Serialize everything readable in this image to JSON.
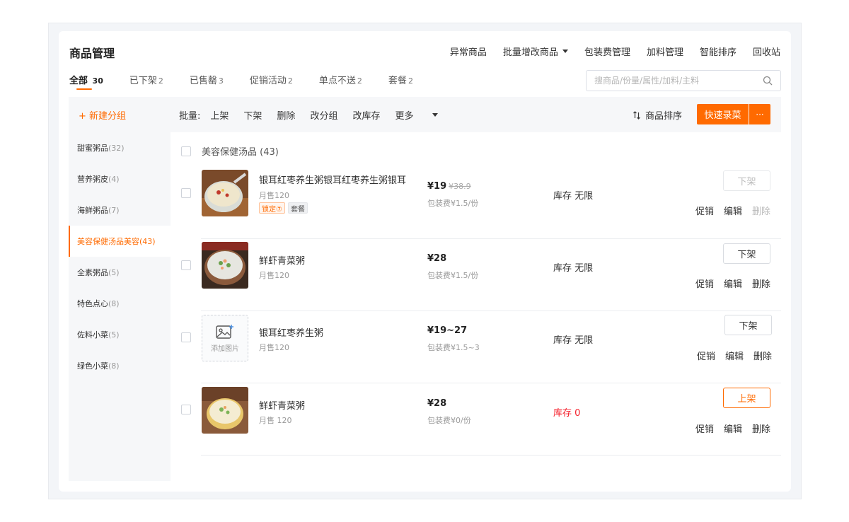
{
  "page": {
    "title": "商品管理",
    "top_actions": [
      "异常商品",
      "批量增改商品",
      "包装费管理",
      "加料管理",
      "智能排序",
      "回收站"
    ]
  },
  "tabs": [
    {
      "label": "全部",
      "count": "30"
    },
    {
      "label": "已下架",
      "count": "2"
    },
    {
      "label": "已售罄",
      "count": "3"
    },
    {
      "label": "促销活动",
      "count": "2"
    },
    {
      "label": "单点不送",
      "count": "2"
    },
    {
      "label": "套餐",
      "count": "2"
    }
  ],
  "search": {
    "placeholder": "搜商品/份量/属性/加料/主料",
    "value": ""
  },
  "toolbar": {
    "new_group": "+ 新建分组",
    "batch_label": "批量:",
    "batch_actions": [
      "上架",
      "下架",
      "删除",
      "改分组",
      "改库存",
      "更多"
    ],
    "sort": "商品排序",
    "quick_add": "快速录菜",
    "more_dots": "···"
  },
  "sidebar": {
    "items": [
      {
        "label": "甜蜜粥品",
        "count": "(32)"
      },
      {
        "label": "营养粥皮",
        "count": "(4)"
      },
      {
        "label": "海鲜粥品",
        "count": "(7)"
      },
      {
        "label": "美容保健汤品美容(43)",
        "count": ""
      },
      {
        "label": "全素粥品",
        "count": "(5)"
      },
      {
        "label": "特色点心",
        "count": "(8)"
      },
      {
        "label": "佐料小菜",
        "count": "(5)"
      },
      {
        "label": "绿色小菜",
        "count": "(8)"
      }
    ]
  },
  "group": {
    "header": "美容保健汤品 (43)"
  },
  "products": [
    {
      "name": "银耳红枣养生粥银耳红枣养生粥银耳",
      "sold": "月售120",
      "tags": [
        "锁定⑦",
        "套餐"
      ],
      "price": "¥19",
      "orig_price": "¥38.9",
      "fee": "包装费¥1.5/份",
      "stock": "库存 无限",
      "shelf_action": "下架",
      "ops": [
        "促销",
        "编辑",
        "删除"
      ]
    },
    {
      "name": "鲜虾青菜粥",
      "sold": "月售120",
      "price": "¥28",
      "fee": "包装费¥1.5/份",
      "stock": "库存 无限",
      "shelf_action": "下架",
      "ops": [
        "促销",
        "编辑",
        "删除"
      ]
    },
    {
      "name": "银耳红枣养生粥",
      "sold": "月售120",
      "add_image": "添加图片",
      "price": "¥19~27",
      "fee": "包装费¥1.5~3",
      "stock": "库存 无限",
      "shelf_action": "下架",
      "ops": [
        "促销",
        "编辑",
        "删除"
      ]
    },
    {
      "name": "鲜虾青菜粥",
      "sold": "月售 120",
      "price": "¥28",
      "fee": "包装费¥0/份",
      "stock": "库存 0",
      "shelf_action": "上架",
      "ops": [
        "促销",
        "编辑",
        "删除"
      ]
    }
  ],
  "colors": {
    "accent": "#ff6a00",
    "danger": "#f5222d",
    "sidebar_bg": "#f6f7f9"
  }
}
